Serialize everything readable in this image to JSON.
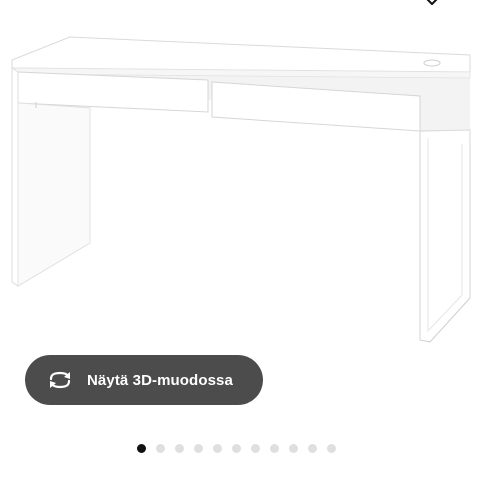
{
  "header": {
    "favourite_icon": "heart-icon"
  },
  "product": {
    "image_subject": "white-desk-with-two-drawers"
  },
  "view_3d": {
    "label": "Näytä 3D-muodossa",
    "icon": "rotate-3d-icon"
  },
  "carousel": {
    "total": 11,
    "active_index": 0
  },
  "colors": {
    "button_bg": "#4c4c4c",
    "button_text": "#ffffff",
    "dot_active": "#111111",
    "dot_inactive": "#dfdfdf"
  }
}
